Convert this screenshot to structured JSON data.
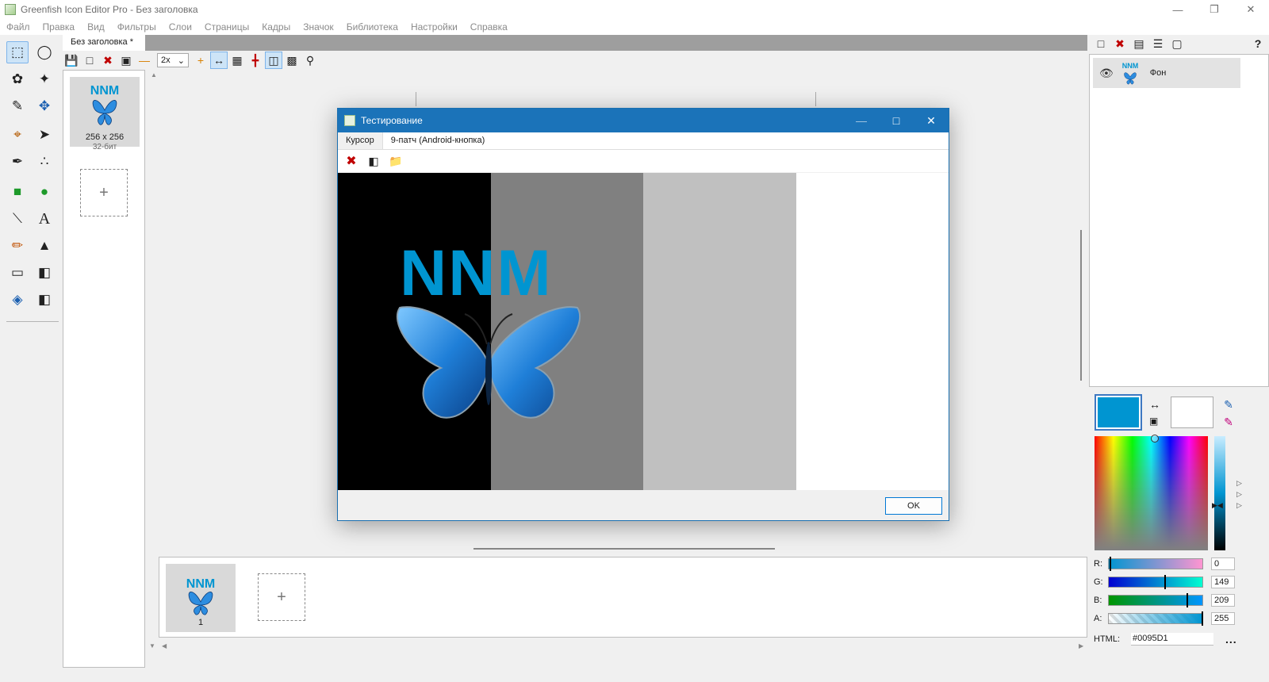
{
  "window": {
    "title": "Greenfish Icon Editor Pro - Без заголовка"
  },
  "menu": [
    "Файл",
    "Правка",
    "Вид",
    "Фильтры",
    "Слои",
    "Страницы",
    "Кадры",
    "Значок",
    "Библиотека",
    "Настройки",
    "Справка"
  ],
  "document_tab": {
    "label": "Без заголовка *"
  },
  "edit_toolbar": {
    "zoom": "2x"
  },
  "pages": {
    "thumb_logo": "NNM",
    "thumb_size": "256 x 256",
    "thumb_bits": "32-бит",
    "add_label": "+"
  },
  "frames": {
    "thumb_logo": "NNM",
    "frame_number": "1",
    "add_label": "+"
  },
  "layers": {
    "items": [
      {
        "logo": "NNM",
        "name": "Фон"
      }
    ]
  },
  "color": {
    "primary": "#0095D1",
    "secondary": "#FFFFFF",
    "r_label": "R:",
    "r_value": "0",
    "g_label": "G:",
    "g_value": "149",
    "b_label": "B:",
    "b_value": "209",
    "a_label": "A:",
    "a_value": "255",
    "html_label": "HTML:",
    "html_value": "#0095D1",
    "more": "..."
  },
  "dialog": {
    "title": "Тестирование",
    "tabs": [
      "Курсор",
      "9-патч (Android-кнопка)"
    ],
    "preview_logo": "NNM",
    "backgrounds": [
      "#000000",
      "#808080",
      "#c0c0c0",
      "#ffffff"
    ],
    "ok_label": "OK"
  }
}
